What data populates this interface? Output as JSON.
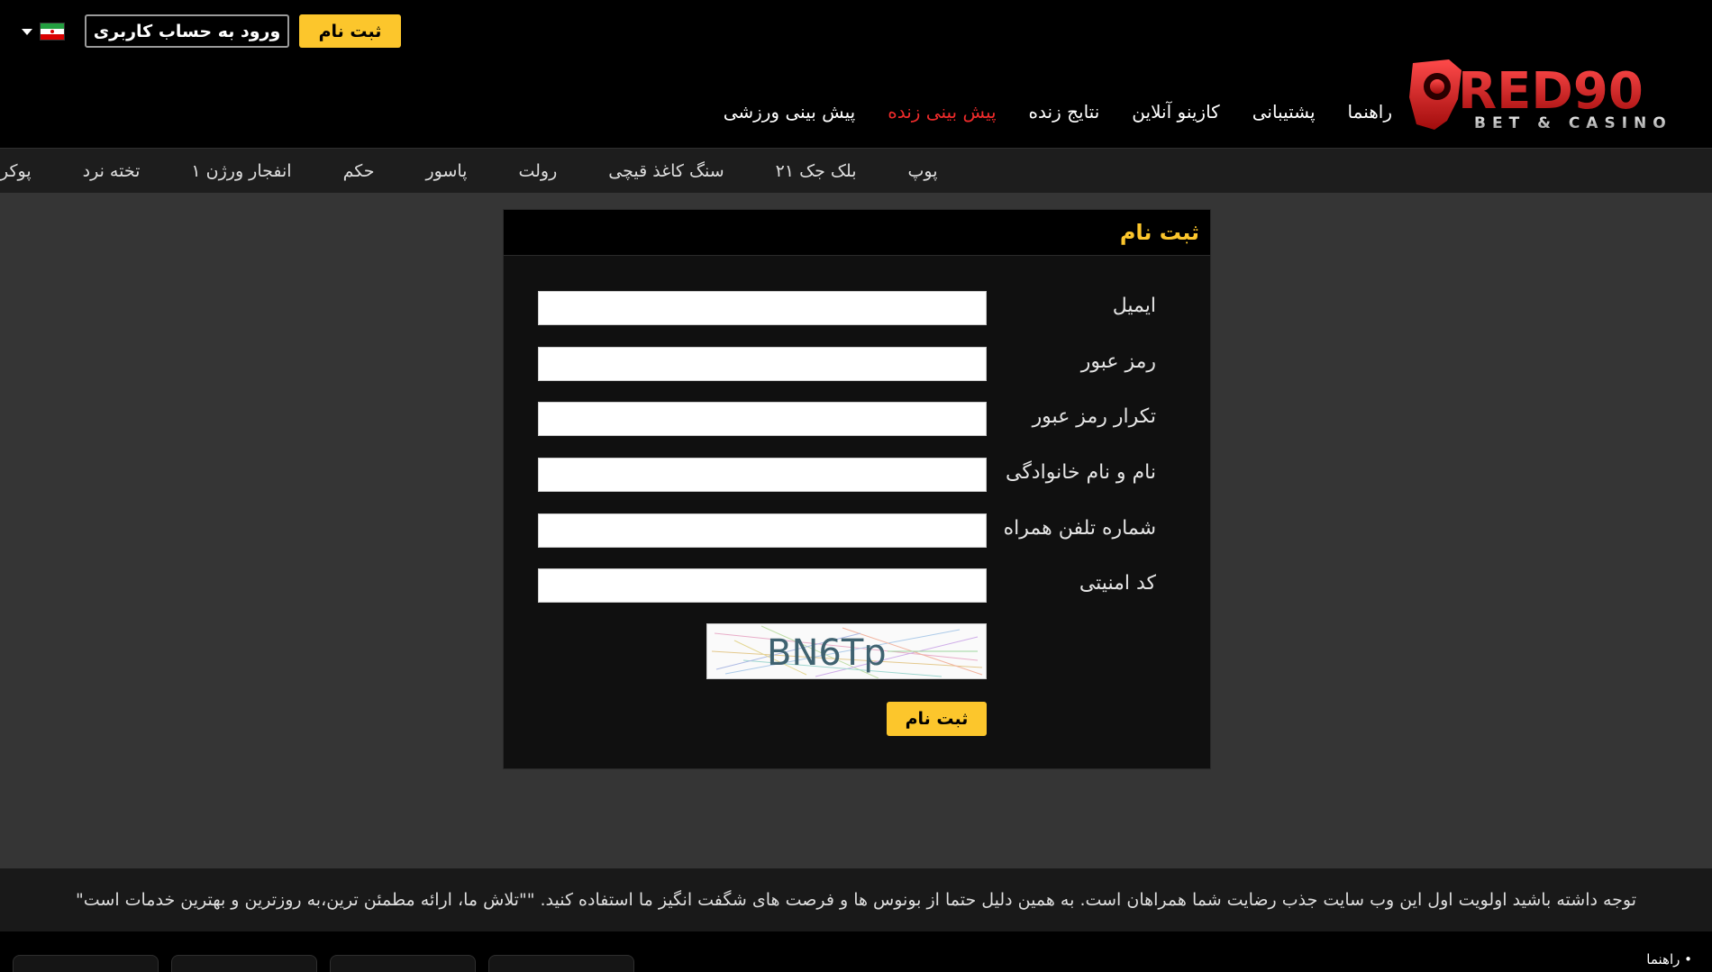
{
  "header": {
    "login_label": "ورود به حساب کاربری",
    "register_label": "ثبت نام",
    "logo_main": "RED90",
    "logo_sub": "BET & CASINO",
    "nav": [
      {
        "label": "پیش بینی ورزشی",
        "active": false
      },
      {
        "label": "پیش بینی زنده",
        "active": true
      },
      {
        "label": "نتایج زنده",
        "active": false
      },
      {
        "label": "کازینو آنلاین",
        "active": false
      },
      {
        "label": "پشتیبانی",
        "active": false
      },
      {
        "label": "راهنما",
        "active": false
      }
    ]
  },
  "subnav": [
    "پوکر",
    "تخته نرد",
    "انفجار ورژن ۱",
    "حکم",
    "پاسور",
    "رولت",
    "سنگ کاغذ قیچی",
    "بلک جک ۲۱",
    "پوپ"
  ],
  "form": {
    "title": "ثبت نام",
    "fields": [
      {
        "label": "ایمیل",
        "value": ""
      },
      {
        "label": "رمز عبور",
        "value": ""
      },
      {
        "label": "تکرار رمز عبور",
        "value": ""
      },
      {
        "label": "نام و نام خانوادگی",
        "value": ""
      },
      {
        "label": "شماره تلفن همراه",
        "value": ""
      },
      {
        "label": "کد امنیتی",
        "value": ""
      }
    ],
    "captcha_text": "BN6Tp",
    "submit_label": "ثبت نام"
  },
  "footer": {
    "notice": "توجه داشته باشید اولویت اول این وب سایت جذب رضایت شما همراهان است. به همین دلیل حتما از بونوس ها و فرصت های شگفت انگیز ما استفاده کنید. \"\"تلاش ما، ارائه مطمئن ترین،به روزترین و بهترین خدمات است\"",
    "guide_label": "• راهنما"
  },
  "colors": {
    "accent": "#fcc62c",
    "active_nav": "#ee2b2b",
    "background": "#353535"
  }
}
